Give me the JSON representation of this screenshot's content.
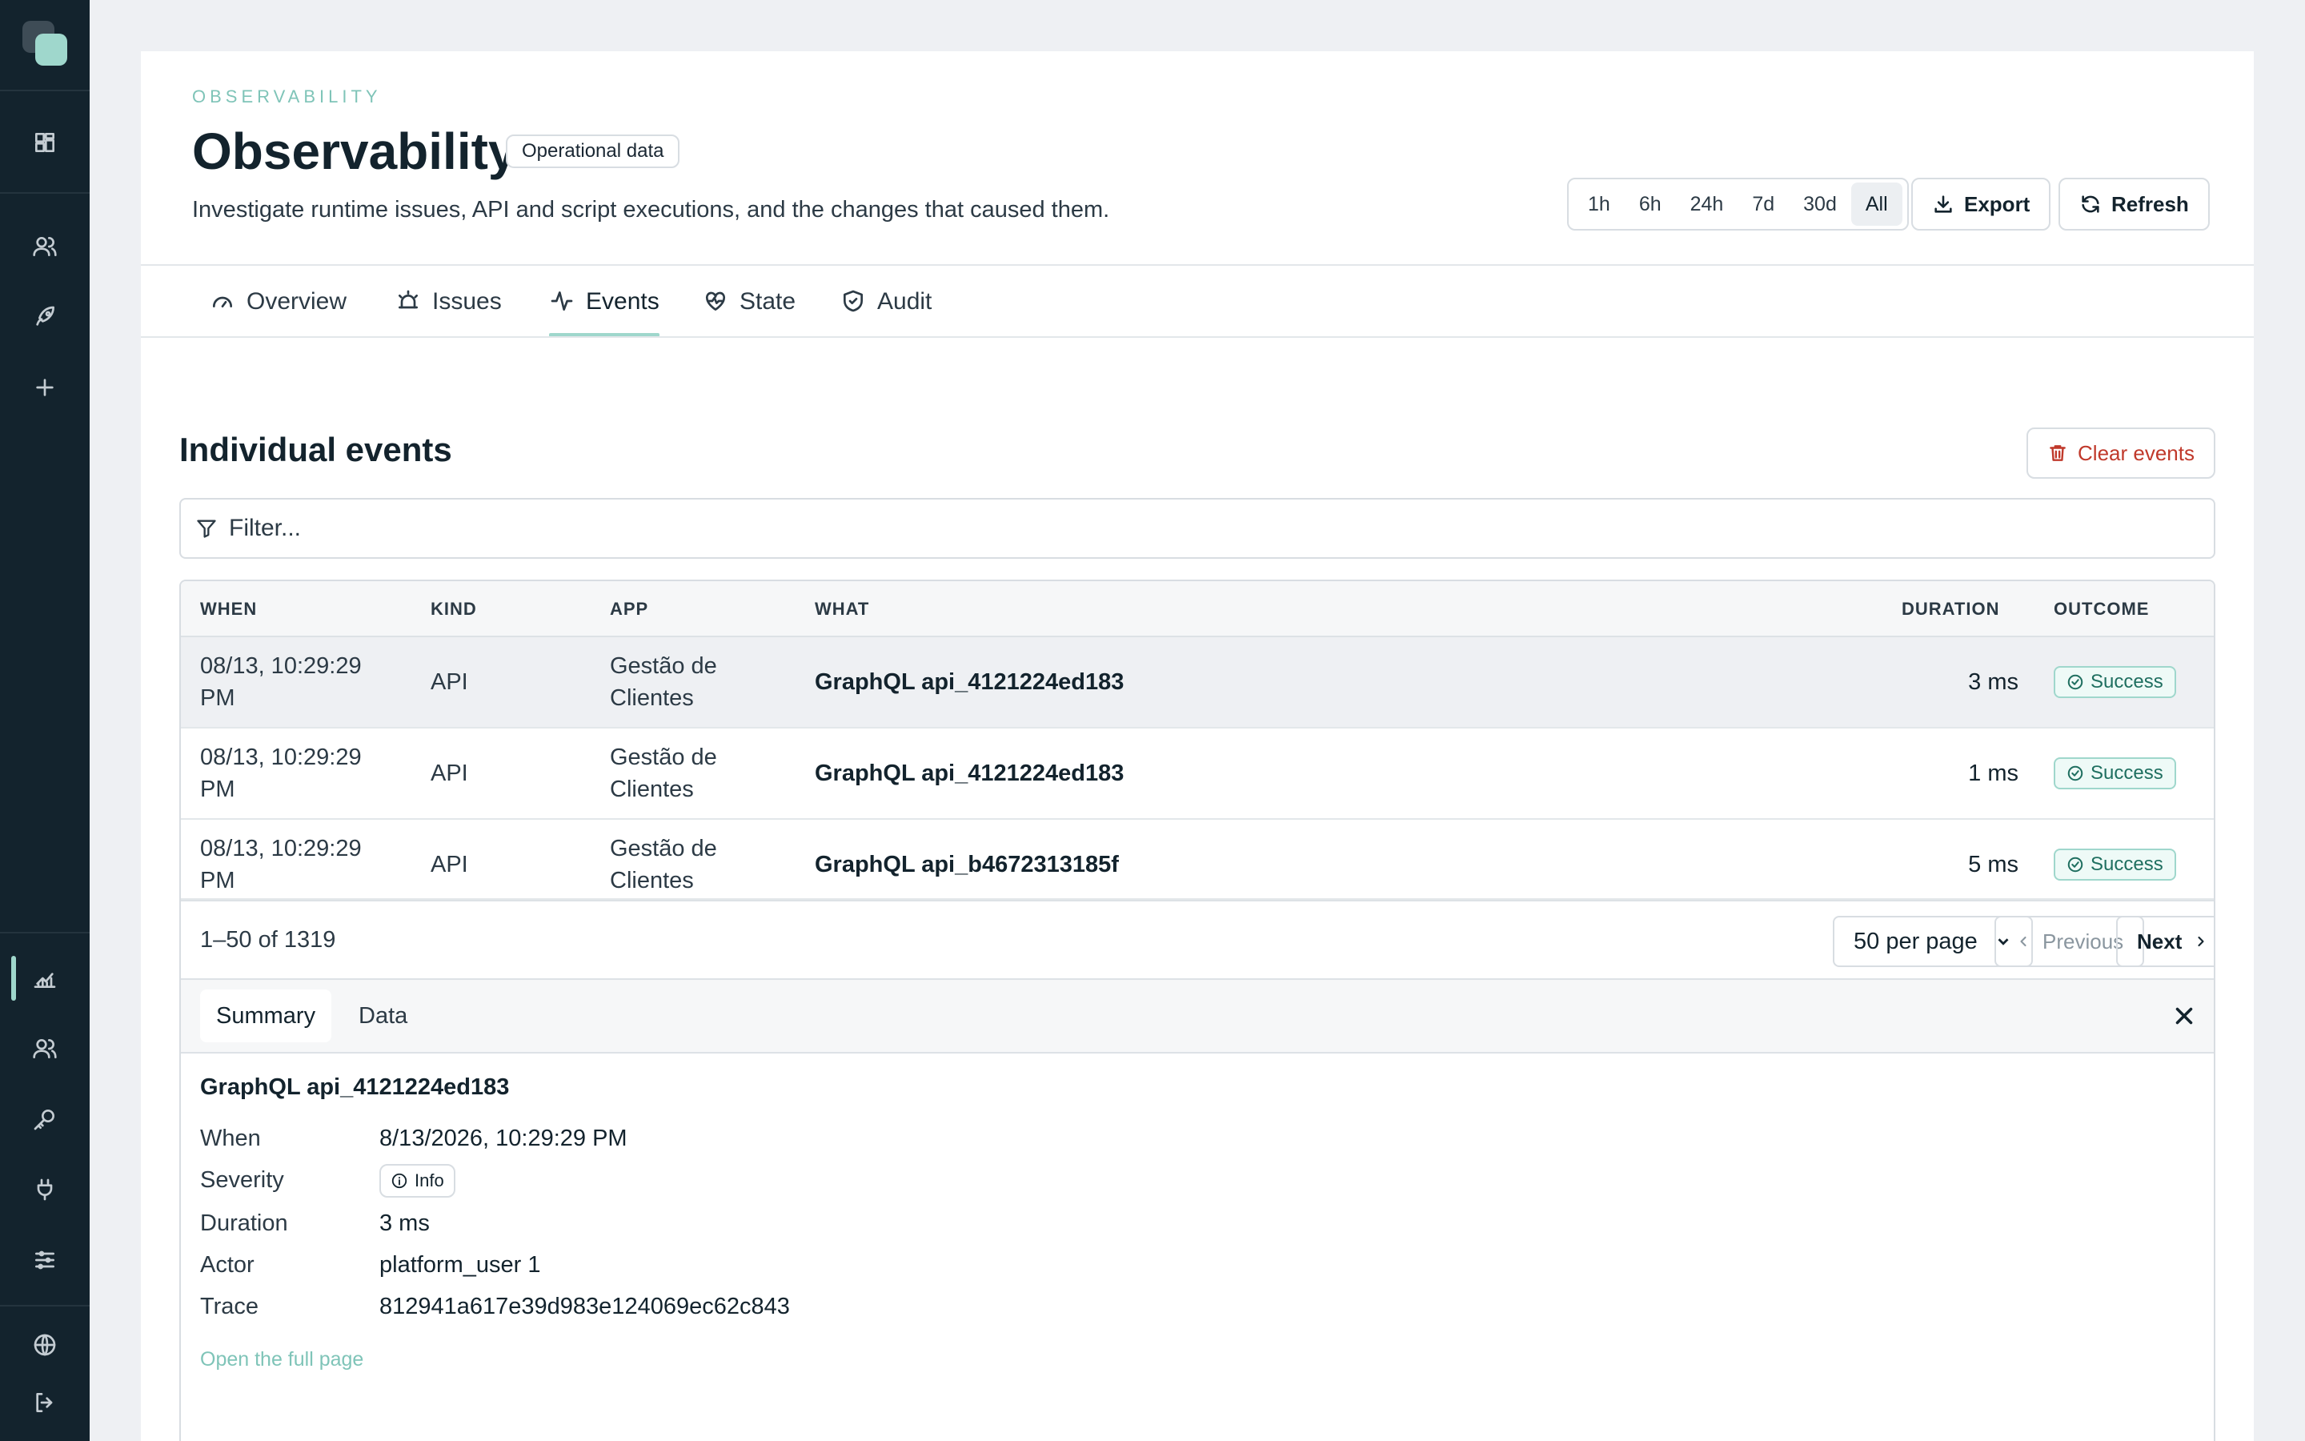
{
  "sidebar": {
    "logo": "app-logo",
    "top_icons": [
      "dashboard-icon",
      "users-icon",
      "rocket-icon",
      "plus-icon"
    ],
    "bottom_icons": [
      "chart-icon",
      "team-icon",
      "key-icon",
      "plug-icon",
      "sliders-icon"
    ],
    "footer_icons": [
      "globe-icon",
      "logout-icon"
    ],
    "accent": "#9fd7cc",
    "background": "#13232d"
  },
  "header": {
    "eyebrow": "OBSERVABILITY",
    "title": "Observability",
    "badge": "Operational data",
    "subtitle": "Investigate runtime issues, API and script executions, and the changes that caused them.",
    "ranges": [
      "1h",
      "6h",
      "24h",
      "7d",
      "30d",
      "All"
    ],
    "active_range": "All",
    "export_label": "Export",
    "refresh_label": "Refresh"
  },
  "tabs": [
    {
      "label": "Overview",
      "icon": "gauge-icon"
    },
    {
      "label": "Issues",
      "icon": "alarm-icon"
    },
    {
      "label": "Events",
      "icon": "activity-icon",
      "active": true
    },
    {
      "label": "State",
      "icon": "heart-pulse-icon"
    },
    {
      "label": "Audit",
      "icon": "shield-check-icon"
    }
  ],
  "events": {
    "section_title": "Individual events",
    "clear_label": "Clear events",
    "filter_placeholder": "Filter...",
    "columns": [
      "WHEN",
      "KIND",
      "APP",
      "WHAT",
      "DURATION",
      "OUTCOME"
    ],
    "rows": [
      {
        "when": "08/13, 10:29:29 PM",
        "kind": "API",
        "app": "Gestão de Clientes",
        "what": "GraphQL api_4121224ed183",
        "duration": "3 ms",
        "outcome": "Success",
        "selected": true
      },
      {
        "when": "08/13, 10:29:29 PM",
        "kind": "API",
        "app": "Gestão de Clientes",
        "what": "GraphQL api_4121224ed183",
        "duration": "1 ms",
        "outcome": "Success"
      },
      {
        "when": "08/13, 10:29:29 PM",
        "kind": "API",
        "app": "Gestão de Clientes",
        "what": "GraphQL api_b4672313185f",
        "duration": "5 ms",
        "outcome": "Success"
      }
    ],
    "pagination": {
      "count": "1–50 of 1319",
      "per_page": "50 per page",
      "previous": "Previous",
      "next": "Next"
    }
  },
  "detail": {
    "tabs": [
      "Summary",
      "Data"
    ],
    "active_tab": "Summary",
    "title": "GraphQL api_4121224ed183",
    "fields": {
      "when_label": "When",
      "when": "8/13/2026, 10:29:29 PM",
      "severity_label": "Severity",
      "severity": "Info",
      "duration_label": "Duration",
      "duration": "3 ms",
      "actor_label": "Actor",
      "actor": "platform_user 1",
      "trace_label": "Trace",
      "trace": "812941a617e39d983e124069ec62c843"
    },
    "open_link": "Open the full page"
  },
  "colors": {
    "success": "#1f6f60",
    "danger": "#c0392b",
    "accent": "#9fd7cc"
  }
}
